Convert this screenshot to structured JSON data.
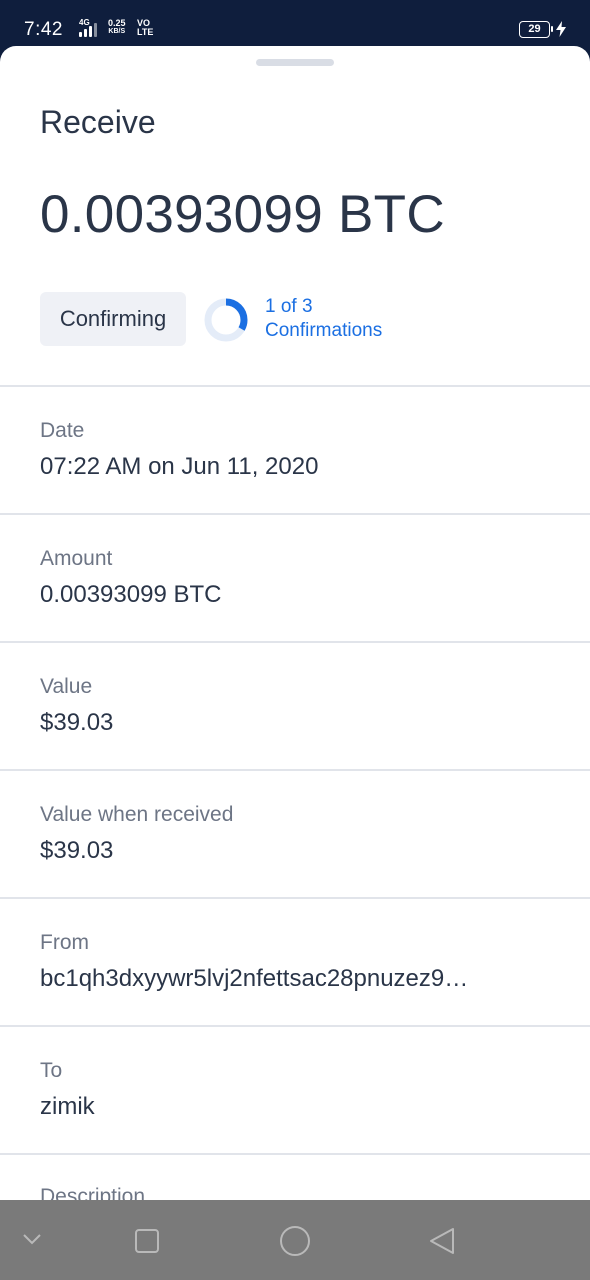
{
  "status_bar": {
    "time": "7:42",
    "network_type": "4G",
    "speed_value": "0.25",
    "speed_unit": "KB/S",
    "volte_top": "VO",
    "volte_bottom": "LTE",
    "battery_level": "29"
  },
  "sheet": {
    "title": "Receive",
    "amount": "0.00393099 BTC",
    "status_chip": "Confirming",
    "confirmations": {
      "line1": "1 of 3",
      "line2": "Confirmations",
      "current": 1,
      "total": 3
    },
    "fields": [
      {
        "label": "Date",
        "value": "07:22 AM on Jun 11, 2020"
      },
      {
        "label": "Amount",
        "value": "0.00393099 BTC"
      },
      {
        "label": "Value",
        "value": "$39.03"
      },
      {
        "label": "Value when received",
        "value": "$39.03"
      },
      {
        "label": "From",
        "value": "bc1qh3dxyywr5lvj2nfettsac28pnuzez9…"
      },
      {
        "label": "To",
        "value": "zimik"
      },
      {
        "label": "Description",
        "value": ""
      }
    ]
  },
  "colors": {
    "accent": "#1b6fe2",
    "status_bar_bg": "#0f1e3d",
    "text_primary": "#2a3548",
    "text_secondary": "#6d7585"
  },
  "nav_bar": {
    "icons": [
      "chevron-down-icon",
      "square-icon",
      "circle-icon",
      "triangle-back-icon"
    ]
  }
}
